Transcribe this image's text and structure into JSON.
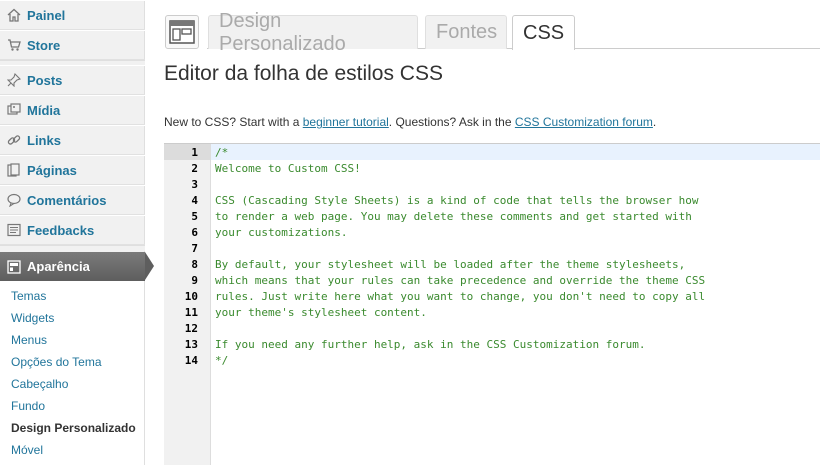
{
  "sidebar": {
    "items": [
      {
        "label": "Painel",
        "icon": "home-icon"
      },
      {
        "label": "Store",
        "icon": "cart-icon"
      },
      {
        "label": "Posts",
        "icon": "pin-icon"
      },
      {
        "label": "Mídia",
        "icon": "media-icon"
      },
      {
        "label": "Links",
        "icon": "link-icon"
      },
      {
        "label": "Páginas",
        "icon": "pages-icon"
      },
      {
        "label": "Comentários",
        "icon": "comment-icon"
      },
      {
        "label": "Feedbacks",
        "icon": "feedback-icon"
      }
    ],
    "active": {
      "label": "Aparência",
      "icon": "appearance-icon"
    },
    "submenu": [
      "Temas",
      "Widgets",
      "Menus",
      "Opções do Tema",
      "Cabeçalho",
      "Fundo",
      "Design Personalizado",
      "Móvel"
    ],
    "current_sub": "Design Personalizado"
  },
  "tabs": [
    "Design Personalizado",
    "Fontes",
    "CSS"
  ],
  "active_tab": "CSS",
  "page_title": "Editor da folha de estilos CSS",
  "intro": {
    "t1": "New to CSS? Start with a ",
    "link1": "beginner tutorial",
    "t2": ". Questions? Ask in the ",
    "link2": "CSS Customization forum",
    "t3": "."
  },
  "editor": {
    "line_numbers": [
      "1",
      "2",
      "3",
      "4",
      "5",
      "6",
      "7",
      "8",
      "9",
      "10",
      "11",
      "12",
      "13",
      "14"
    ],
    "lines": [
      "/*",
      "Welcome to Custom CSS!",
      "",
      "CSS (Cascading Style Sheets) is a kind of code that tells the browser how",
      "to render a web page. You may delete these comments and get started with",
      "your customizations.",
      "",
      "By default, your stylesheet will be loaded after the theme stylesheets,",
      "which means that your rules can take precedence and override the theme CSS",
      "rules. Just write here what you want to change, you don't need to copy all",
      "your theme's stylesheet content.",
      "",
      "If you need any further help, ask in the CSS Customization forum.",
      "*/"
    ]
  }
}
